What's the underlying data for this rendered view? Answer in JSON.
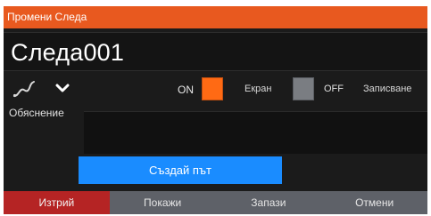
{
  "dialog": {
    "title": "Промени Следа",
    "name_value": "Следа001"
  },
  "toggles": {
    "on_label": "ON",
    "screen_label": "Екран",
    "off_label": "OFF",
    "record_label": "Записване",
    "screen_on_color": "#ff6a14",
    "record_off_color": "#7a7d82"
  },
  "description": {
    "label": "Обяснение",
    "value": ""
  },
  "actions": {
    "create_route": "Създай път"
  },
  "footer": {
    "delete": "Изтрий",
    "show": "Покажи",
    "save": "Запази",
    "cancel": "Отмени"
  },
  "colors": {
    "accent": "#e8591f",
    "primary_button": "#1a8cff",
    "danger": "#b52424"
  }
}
